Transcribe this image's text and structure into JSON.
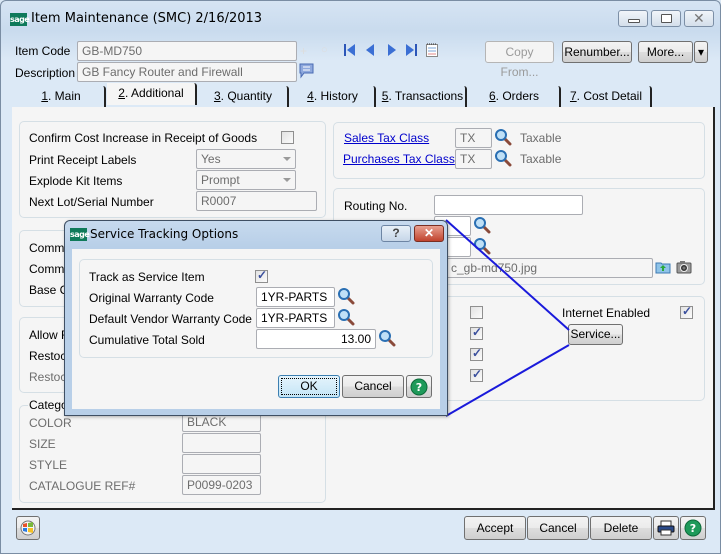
{
  "window": {
    "title": "Item Maintenance (SMC) 2/16/2013",
    "logo_text": "sage",
    "controls": [
      "minimize",
      "maximize",
      "close"
    ]
  },
  "header": {
    "item_code_label": "Item Code",
    "item_code_value": "GB-MD750",
    "description_label": "Description",
    "description_value": "GB Fancy Router and Firewall",
    "nav_icons": [
      "add-icon",
      "refresh-icon",
      "first-record-icon",
      "previous-record-icon",
      "next-record-icon",
      "last-record-icon",
      "notepad-icon"
    ],
    "buttons": {
      "copy_from": "Copy From...",
      "renumber": "Renumber...",
      "more": "More...",
      "more_dropdown": "▾"
    }
  },
  "tabs": [
    {
      "key": "1",
      "label": ". Main",
      "active": false
    },
    {
      "key": "2",
      "label": ". Additional",
      "active": true
    },
    {
      "key": "3",
      "label": ". Quantity",
      "active": false
    },
    {
      "key": "4",
      "label": ". History",
      "active": false
    },
    {
      "key": "5",
      "label": ". Transactions",
      "active": false
    },
    {
      "key": "6",
      "label": ". Orders",
      "active": false
    },
    {
      "key": "7",
      "label": ". Cost Detail",
      "active": false
    }
  ],
  "receipt_group": {
    "confirm_cost_label": "Confirm Cost Increase in Receipt of Goods",
    "confirm_cost_checked": false,
    "print_labels_label": "Print Receipt Labels",
    "print_labels_value": "Yes",
    "explode_kit_label": "Explode Kit Items",
    "explode_kit_value": "Prompt",
    "next_lot_label": "Next Lot/Serial Number",
    "next_lot_value": "R0007"
  },
  "commission_group": {
    "rows": [
      "Commis",
      "Commis",
      "Base Co"
    ]
  },
  "returns_group": {
    "rows": [
      "Allow R",
      "Restock",
      "Restock"
    ]
  },
  "category_group": {
    "title": "Categor",
    "rows": [
      {
        "label": "COLOR",
        "value": "BLACK"
      },
      {
        "label": "SIZE",
        "value": ""
      },
      {
        "label": "STYLE",
        "value": ""
      },
      {
        "label": "CATALOGUE REF#",
        "value": "P0099-0203"
      }
    ]
  },
  "tax_group": {
    "sales_tax_label": "Sales Tax Class",
    "sales_tax_value": "TX",
    "sales_tax_desc": "Taxable",
    "purchases_tax_label": "Purchases Tax Class",
    "purchases_tax_value": "TX",
    "purchases_tax_desc": "Taxable"
  },
  "routing_group": {
    "routing_label": "Routing No.",
    "routing_value": "",
    "image_value": "c_gb-md750.jpg"
  },
  "options_group": {
    "checkboxes": [
      false,
      true,
      true,
      true
    ],
    "internet_enabled_label": "Internet Enabled",
    "internet_enabled_checked": true,
    "service_button": "Service..."
  },
  "footer": {
    "accept": "Accept",
    "cancel": "Cancel",
    "delete": "Delete"
  },
  "dialog": {
    "title": "Service Tracking Options",
    "logo_text": "sage",
    "help_btn": "?",
    "close_btn": "✕",
    "track_label": "Track as Service Item",
    "track_checked": true,
    "orig_warranty_label": "Original Warranty Code",
    "orig_warranty_value": "1YR-PARTS",
    "vendor_warranty_label": "Default Vendor Warranty Code",
    "vendor_warranty_value": "1YR-PARTS",
    "cumulative_label": "Cumulative Total Sold",
    "cumulative_value": "13.00",
    "ok": "OK",
    "cancel": "Cancel"
  },
  "colors": {
    "accent_link": "#0000cc",
    "callout_line": "#1a1adb",
    "sage_green": "#0f7a5a"
  }
}
